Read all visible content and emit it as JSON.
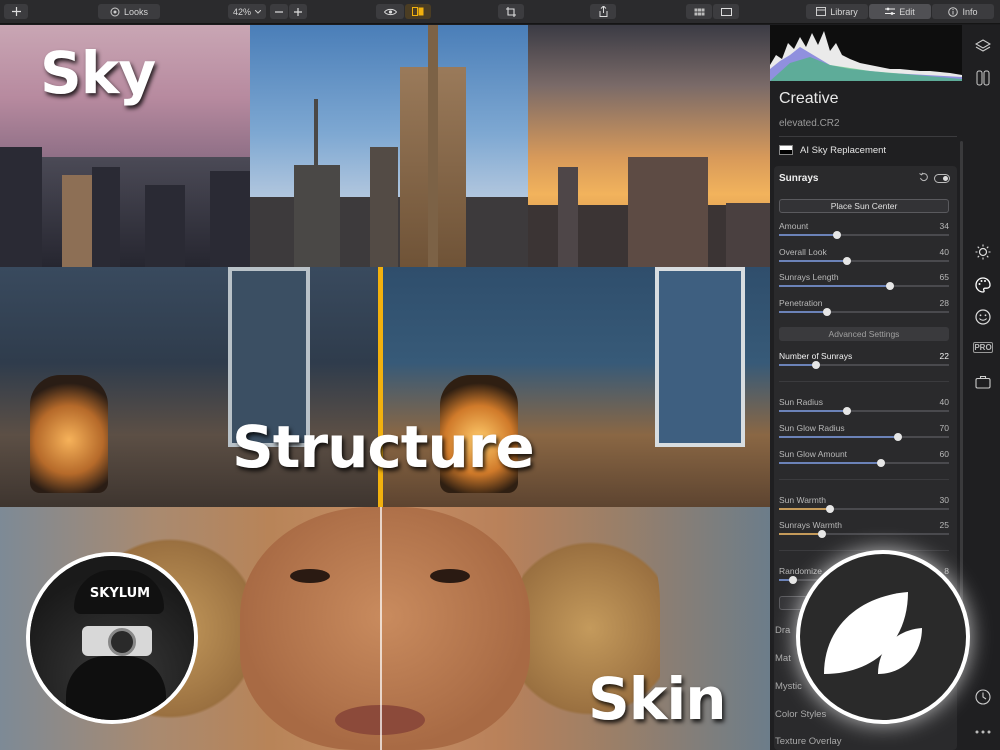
{
  "toolbar": {
    "looks_label": "Looks",
    "zoom": "42%",
    "tabs": [
      {
        "label": "Library"
      },
      {
        "label": "Edit"
      },
      {
        "label": "Info"
      }
    ]
  },
  "canvas": {
    "labels": {
      "sky": "Sky",
      "structure": "Structure",
      "skin": "Skin"
    },
    "avatar_cap_text": "SKYLUM"
  },
  "sidebar": {
    "title": "Creative",
    "filename": "elevated.CR2",
    "ai_tool_label": "AI Sky Replacement",
    "panel_title": "Sunrays",
    "place_sun_button": "Place Sun Center",
    "advanced_settings": "Advanced Settings",
    "sliders": [
      {
        "label": "Amount",
        "value": "34"
      },
      {
        "label": "Overall Look",
        "value": "40"
      },
      {
        "label": "Sunrays Length",
        "value": "65"
      },
      {
        "label": "Penetration",
        "value": "28"
      },
      {
        "label": "Number of Sunrays",
        "value": "22"
      },
      {
        "label": "Sun Radius",
        "value": "40"
      },
      {
        "label": "Sun Glow Radius",
        "value": "70"
      },
      {
        "label": "Sun Glow Amount",
        "value": "60"
      },
      {
        "label": "Sun Warmth",
        "value": "30"
      },
      {
        "label": "Sunrays Warmth",
        "value": "25"
      },
      {
        "label": "Randomize",
        "value": "8"
      }
    ],
    "tools": [
      {
        "label": "Dra"
      },
      {
        "label": "Mat"
      },
      {
        "label": "Mystic"
      },
      {
        "label": "Color Styles"
      },
      {
        "label": "Texture Overlay"
      }
    ],
    "pro_badge": "PRO"
  },
  "colors": {
    "accent_gold": "#f2b10e",
    "slider_fill": "#6b82b8",
    "panel_bg": "#2a2a2c"
  },
  "icons": [
    "plus-icon",
    "looks-icon",
    "eye-icon",
    "compare-icon",
    "crop-icon",
    "share-icon",
    "grid-view-icon",
    "single-view-icon",
    "library-icon",
    "edit-icon",
    "info-icon",
    "layers-icon",
    "adjust-icon",
    "sun-icon",
    "palette-icon",
    "smile-icon",
    "briefcase-icon",
    "history-icon",
    "more-icon",
    "reset-icon",
    "toggle-icon"
  ]
}
